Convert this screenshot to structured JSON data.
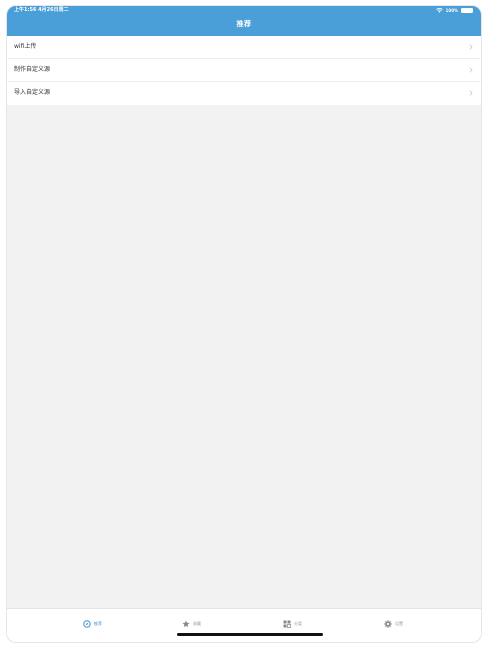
{
  "status_bar": {
    "time": "上午1:56  4月26日周二",
    "battery": "100%"
  },
  "nav": {
    "title": "推荐"
  },
  "menu": {
    "items": [
      {
        "label": "wifi上传"
      },
      {
        "label": "制作自定义源"
      },
      {
        "label": "导入自定义源"
      }
    ]
  },
  "tabs": [
    {
      "label": "推荐",
      "icon": "compass-icon",
      "active": true
    },
    {
      "label": "收藏",
      "icon": "star-icon",
      "active": false
    },
    {
      "label": "分类",
      "icon": "grid-icon",
      "active": false
    },
    {
      "label": "设置",
      "icon": "gear-icon",
      "active": false
    }
  ],
  "colors": {
    "accent": "#4a9fd8",
    "active_tab": "#3a8fd6",
    "background": "#f2f2f2"
  }
}
